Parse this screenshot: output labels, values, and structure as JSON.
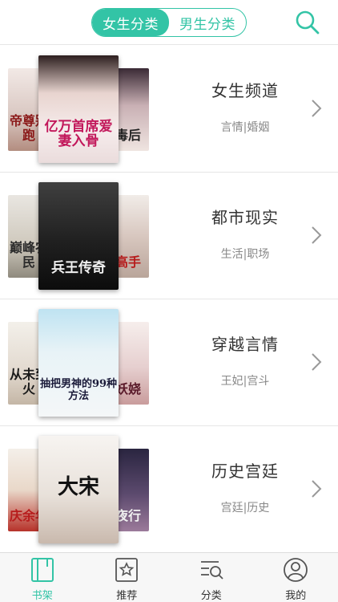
{
  "header": {
    "tabs": [
      {
        "label": "女生分类",
        "active": true
      },
      {
        "label": "男生分类",
        "active": false
      }
    ],
    "search_icon": "search-icon"
  },
  "categories": [
    {
      "name": "女生频道",
      "tags": "言情|婚姻",
      "covers": {
        "left": "帝尊别跑",
        "center": "亿万首席爱妻入骨",
        "right": "毒后"
      }
    },
    {
      "name": "都市现实",
      "tags": "生活|职场",
      "covers": {
        "left": "巅峰农民",
        "center": "兵王传奇",
        "right": "高手"
      }
    },
    {
      "name": "穿越言情",
      "tags": "王妃|宫斗",
      "covers": {
        "left": "从未到火",
        "center": "抽把男神的99种方法",
        "right": "妖娆"
      }
    },
    {
      "name": "历史宫廷",
      "tags": "宫廷|历史",
      "covers": {
        "left": "庆余年",
        "center": "大宋",
        "right": "夜行"
      }
    }
  ],
  "tabbar": [
    {
      "label": "书架",
      "icon": "bookshelf-icon",
      "active": true
    },
    {
      "label": "推荐",
      "icon": "star-icon",
      "active": false
    },
    {
      "label": "分类",
      "icon": "category-search-icon",
      "active": false
    },
    {
      "label": "我的",
      "icon": "user-icon",
      "active": false
    }
  ],
  "colors": {
    "accent": "#33c4a6",
    "text": "#333333",
    "subtext": "#888888",
    "divider": "#e6e6e6",
    "tabbar_bg": "#f7f7f7"
  }
}
